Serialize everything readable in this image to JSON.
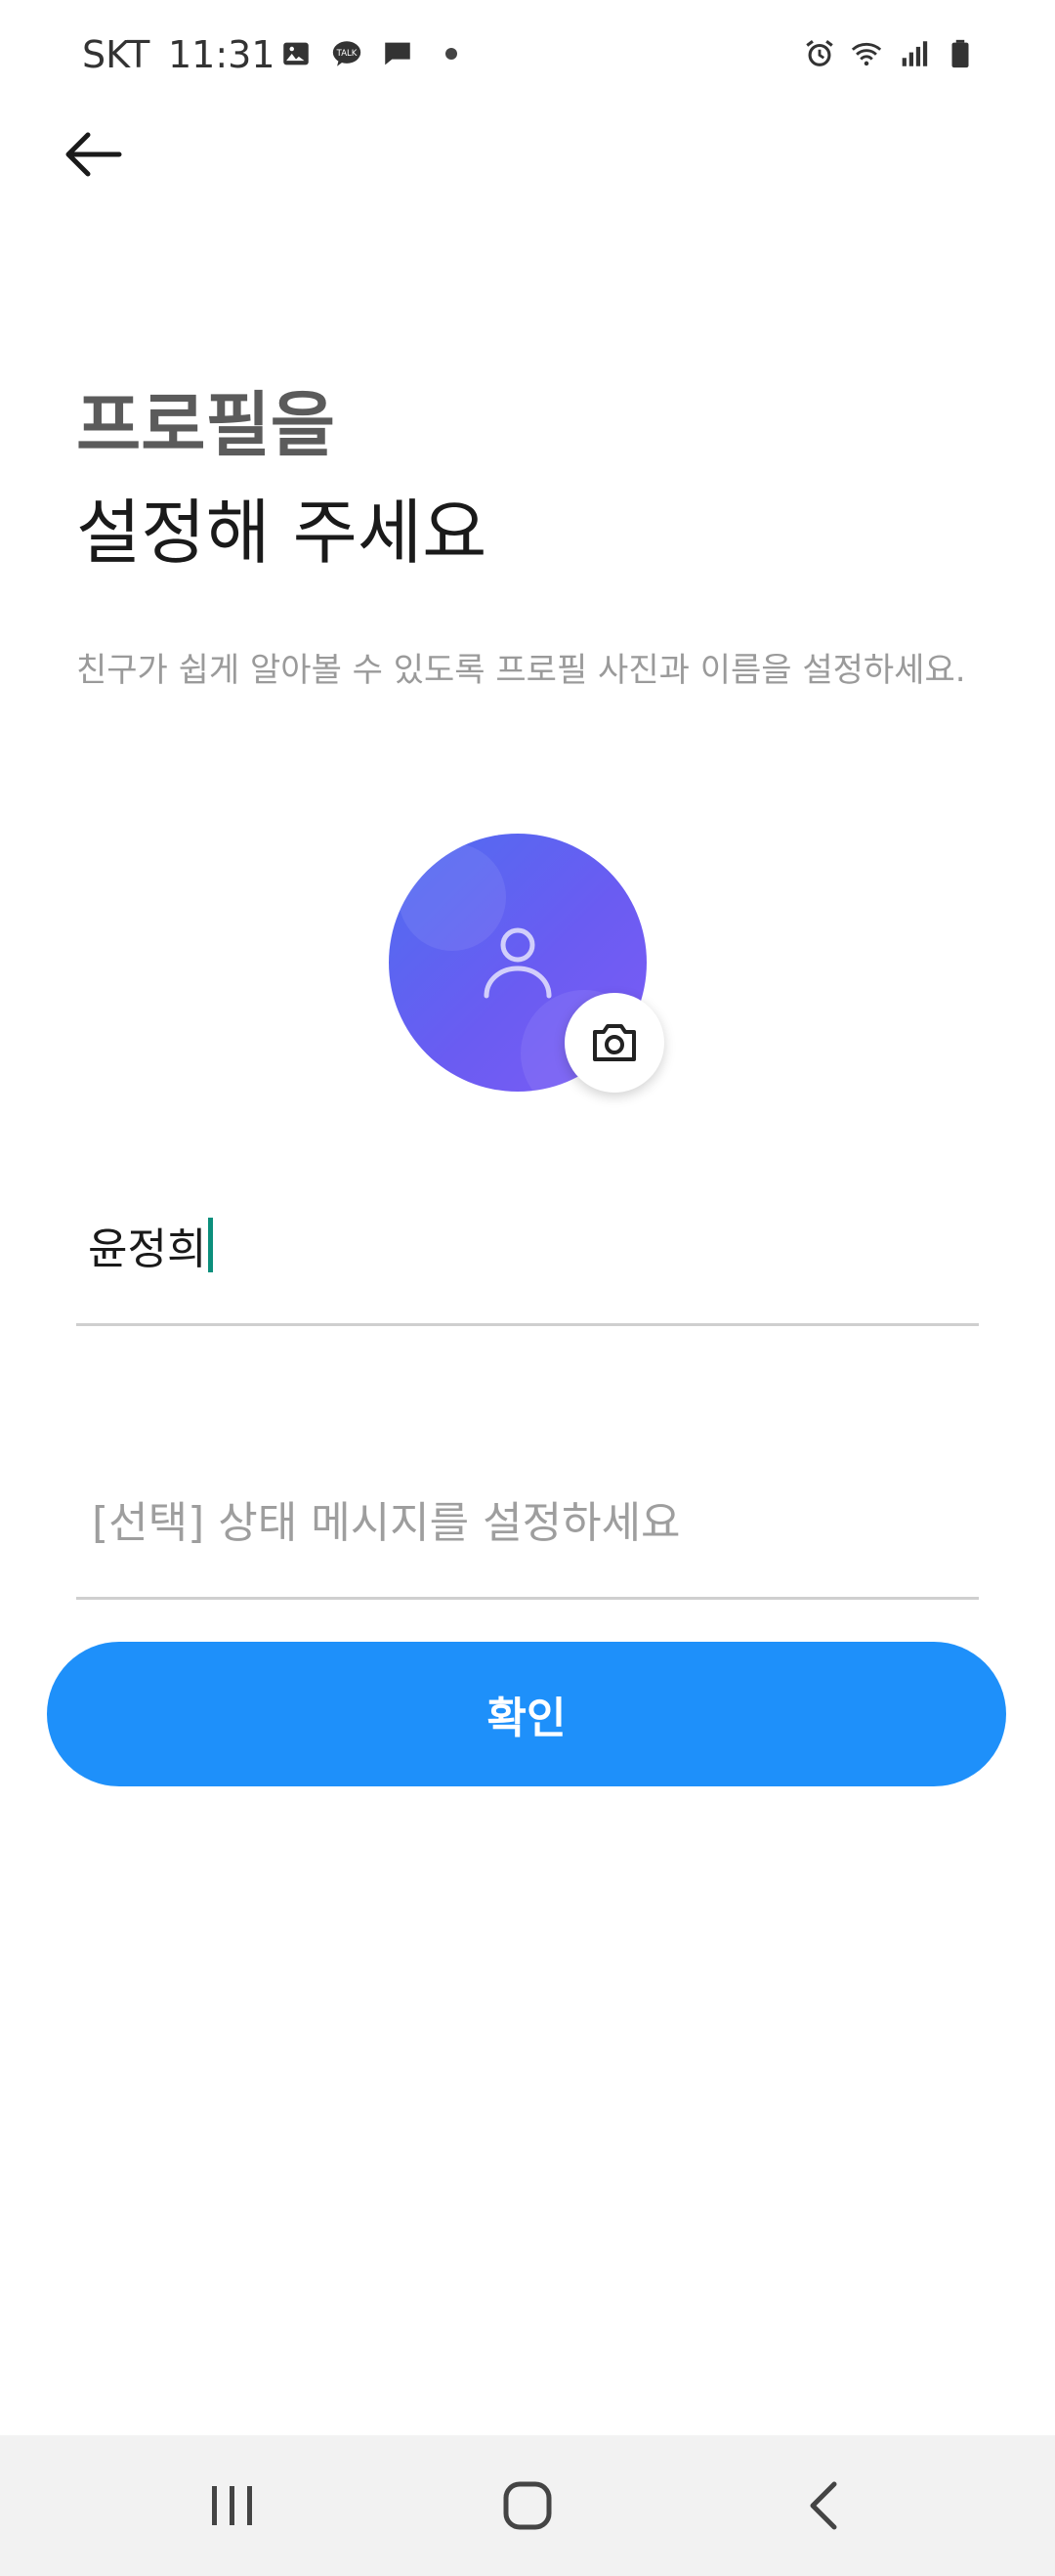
{
  "status_bar": {
    "carrier": "SKT",
    "time": "11:31",
    "left_icons": [
      "image-icon",
      "talk-icon",
      "message-icon",
      "dot-icon"
    ],
    "right_icons": [
      "alarm-icon",
      "wifi-icon",
      "signal-icon",
      "battery-icon"
    ],
    "talk_badge": "TALK"
  },
  "header": {
    "back_icon": "arrow-left-icon"
  },
  "title": {
    "line1": "프로필을",
    "line2": "설정해 주세요"
  },
  "subtitle": "친구가 쉽게 알아볼 수 있도록 프로필 사진과 이름을 설정하세요.",
  "avatar": {
    "icon": "person-icon",
    "camera_icon": "camera-icon",
    "color_start": "#4f6df0",
    "color_end": "#7c5cf5"
  },
  "name_field": {
    "value": "윤정희"
  },
  "status_field": {
    "placeholder": "[선택] 상태 메시지를 설정하세요"
  },
  "confirm_button": {
    "label": "확인",
    "color": "#1e90fa"
  },
  "nav_bar": {
    "icons": [
      "recent-apps-icon",
      "home-icon",
      "back-icon"
    ]
  }
}
